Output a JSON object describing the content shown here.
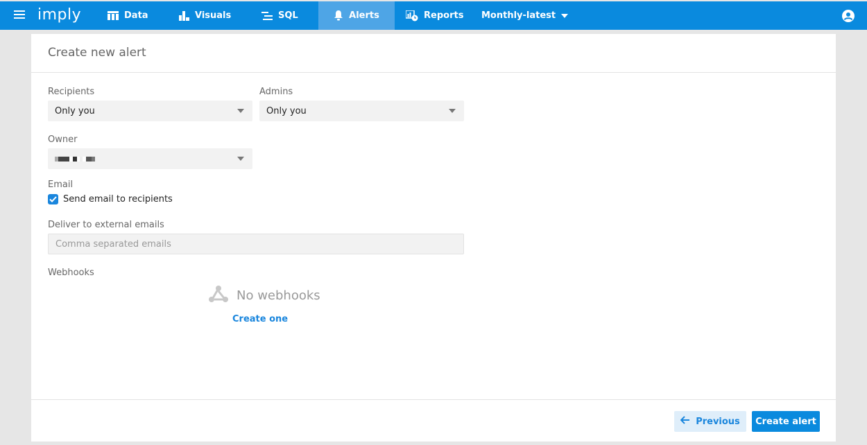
{
  "app": {
    "logo": "imply",
    "brand_color": "#0a8ade"
  },
  "nav": {
    "items": [
      {
        "label": "Data",
        "icon": "table-icon"
      },
      {
        "label": "Visuals",
        "icon": "bar-chart-icon"
      },
      {
        "label": "SQL",
        "icon": "sql-icon"
      },
      {
        "label": "Alerts",
        "icon": "bell-icon",
        "active": true
      },
      {
        "label": "Reports",
        "icon": "report-clock-icon"
      }
    ],
    "datasource": "Monthly-latest"
  },
  "page": {
    "title": "Create new alert"
  },
  "form": {
    "recipients": {
      "label": "Recipients",
      "value": "Only you"
    },
    "admins": {
      "label": "Admins",
      "value": "Only you"
    },
    "owner": {
      "label": "Owner",
      "value_redacted": true
    },
    "email": {
      "label": "Email",
      "checkbox_label": "Send email to recipients",
      "checked": true
    },
    "external_emails": {
      "label": "Deliver to external emails",
      "placeholder": "Comma separated emails",
      "value": ""
    },
    "webhooks": {
      "label": "Webhooks",
      "empty_text": "No webhooks",
      "create_link": "Create one"
    }
  },
  "footer": {
    "previous_label": "Previous",
    "create_label": "Create alert"
  }
}
